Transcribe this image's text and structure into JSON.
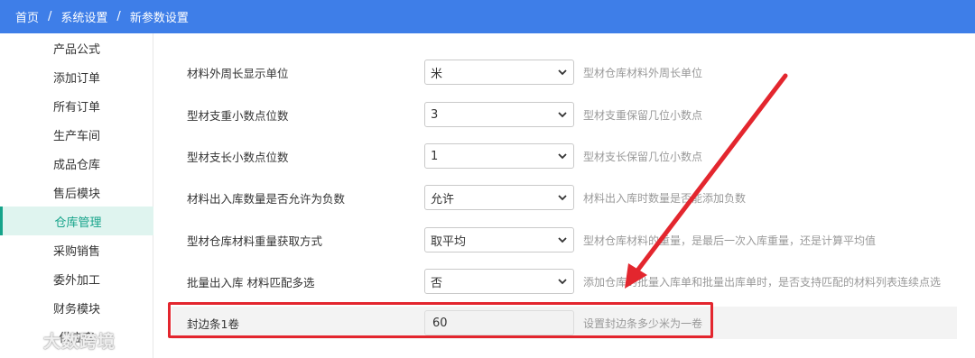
{
  "breadcrumb": {
    "items": [
      "首页",
      "系统设置",
      "新参数设置"
    ],
    "separator": "/"
  },
  "sidebar": {
    "items": [
      {
        "label": "产品公式"
      },
      {
        "label": "添加订单"
      },
      {
        "label": "所有订单"
      },
      {
        "label": "生产车间"
      },
      {
        "label": "成品仓库"
      },
      {
        "label": "售后模块"
      },
      {
        "label": "仓库管理",
        "active": true
      },
      {
        "label": "采购销售"
      },
      {
        "label": "委外加工"
      },
      {
        "label": "财务模块"
      },
      {
        "label": "供应商"
      }
    ]
  },
  "settings": [
    {
      "label": "材料外周长显示单位",
      "value": "米",
      "hint": "型材仓库材料外周长单位",
      "control": "select"
    },
    {
      "label": "型材支重小数点位数",
      "value": "3",
      "hint": "型材支重保留几位小数点",
      "control": "select"
    },
    {
      "label": "型材支长小数点位数",
      "value": "1",
      "hint": "型材支长保留几位小数点",
      "control": "select"
    },
    {
      "label": "材料出入库数量是否允许为负数",
      "value": "允许",
      "hint": "材料出入库时数量是否能添加负数",
      "control": "select"
    },
    {
      "label": "型材仓库材料重量获取方式",
      "value": "取平均",
      "hint": "型材仓库材料的重量，是最后一次入库重量，还是计算平均值",
      "control": "select"
    },
    {
      "label": "批量出入库 材料匹配多选",
      "value": "否",
      "hint": "添加仓库的批量入库单和批量出库单时，是否支持匹配的材料列表连续点选",
      "control": "select"
    },
    {
      "label": "封边条1卷",
      "value": "60",
      "hint": "设置封边条多少米为一卷",
      "control": "input"
    }
  ],
  "annotation": {
    "color": "#e3262e"
  },
  "watermark": {
    "text": "大数跨境"
  },
  "colors": {
    "topbar": "#3e7ee8",
    "accent": "#15a38a"
  }
}
